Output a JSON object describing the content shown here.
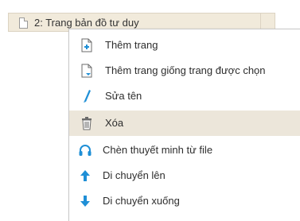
{
  "page_list": {
    "selected_page": {
      "label": "2: Trang bản đồ tư duy",
      "icon": "page-document-icon"
    }
  },
  "context_menu": {
    "items": [
      {
        "label": "Thêm trang",
        "icon": "add-page-icon"
      },
      {
        "label": "Thêm trang giống trang được chọn",
        "icon": "duplicate-page-icon"
      },
      {
        "label": "Sửa tên",
        "icon": "rename-pen-icon"
      },
      {
        "label": "Xóa",
        "icon": "trash-icon",
        "highlighted": true
      },
      {
        "label": "Chèn thuyết minh từ file",
        "icon": "headphones-icon"
      },
      {
        "label": "Di chuyển lên",
        "icon": "arrow-up-icon"
      },
      {
        "label": "Di chuyển xuống",
        "icon": "arrow-down-icon"
      }
    ]
  },
  "colors": {
    "highlight": "#ece6da",
    "accent_blue": "#1f8fd6",
    "selected_page_bg": "#f1eadb"
  }
}
